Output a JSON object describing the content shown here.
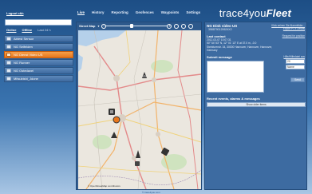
{
  "header": {
    "logout": "Logout ckh",
    "nav": [
      {
        "label": "Live",
        "active": true
      },
      {
        "label": "History",
        "active": false
      },
      {
        "label": "Reporting",
        "active": false
      },
      {
        "label": "Geofences",
        "active": false
      },
      {
        "label": "Waypoints",
        "active": false
      },
      {
        "label": "Settings",
        "active": false
      }
    ],
    "logo_text": "trace4you",
    "logo_bold": "Fleet"
  },
  "sidebar": {
    "filters": {
      "online": "Online",
      "offline": "Offline",
      "note": "Last 24 h"
    },
    "vehicles": [
      {
        "label": "Abtest Sensor",
        "selected": false
      },
      {
        "label": "NG Seifelden",
        "selected": false
      },
      {
        "label": "NG Dienst Video US",
        "selected": true
      },
      {
        "label": "NG Runner",
        "selected": false
      },
      {
        "label": "NG Ostedavel",
        "selected": false
      },
      {
        "label": "Mitsubishi_Jdone",
        "selected": false
      }
    ]
  },
  "map": {
    "type_label": "Street Map",
    "attribution": "© OpenStreetMap contributors"
  },
  "panel": {
    "vehicle_name": "NG Dink video US",
    "vehicle_number": "3588790120624X2",
    "link_alarms": "Klick seinen Sie Alarmbilder...",
    "link_export": "Export P1 x Details",
    "last_contact_label": "Last contact",
    "link_position": "Request for position",
    "last_contact_lines": [
      "2012-03-07 10:07:31",
      "50° 54' 53\" N, 12° 01' 13\" E at 37.0 m, -0.0",
      "Steinfurerstr. 34, 30000 Hannover, Hannover, Hannover,",
      "Germany"
    ],
    "submit_label": "Submit message",
    "submit_link": "Hilfe/Hilfedatei aus",
    "input_a": "20",
    "input_b": "Name",
    "send_label": "Send",
    "events_label": "Recent events, alarms & messages",
    "older_label": "Show older items"
  },
  "footer": "© trace4you.com"
}
